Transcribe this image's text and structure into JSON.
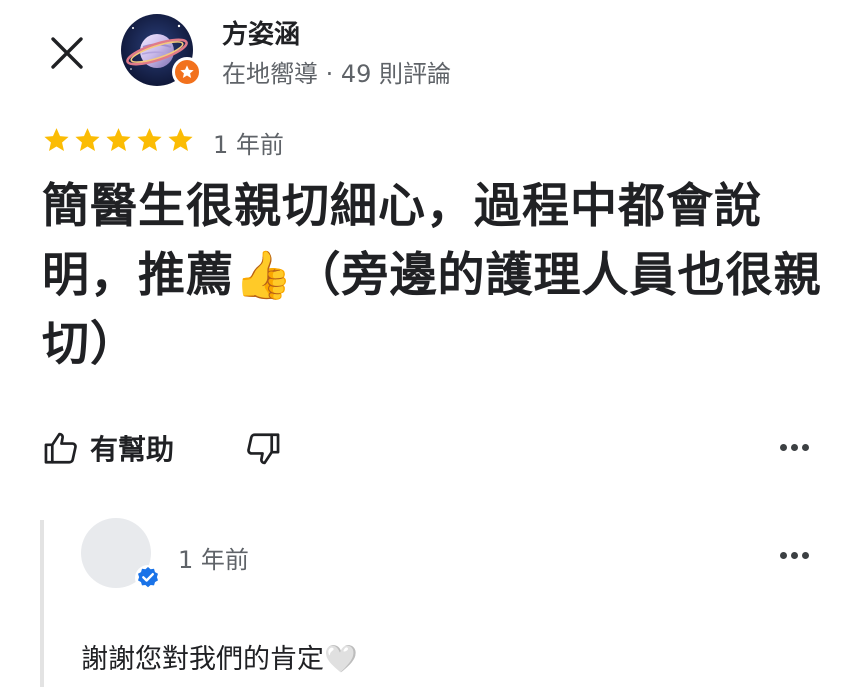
{
  "header": {
    "close_icon": "close-icon",
    "user": {
      "name": "方姿涵",
      "meta": "在地嚮導 · 49 則評論",
      "badge_icon": "local-guide-star-icon"
    }
  },
  "review": {
    "rating": 5,
    "rating_max": 5,
    "time": "1 年前",
    "text": "簡醫生很親切細心，過程中都會說明，推薦👍（旁邊的護理人員也很親切）"
  },
  "actions": {
    "helpful_label": "有幫助",
    "like_icon": "thumbs-up-icon",
    "dislike_icon": "thumbs-down-icon",
    "more_icon": "more-horizontal-icon"
  },
  "owner_response": {
    "time": "1 年前",
    "text": "謝謝您對我們的肯定🤍",
    "verified_icon": "verified-check-icon"
  },
  "colors": {
    "star": "#fbbc04",
    "badge": "#f2711c",
    "verified": "#1a73e8",
    "text_primary": "#202124",
    "text_secondary": "#5f6368"
  }
}
